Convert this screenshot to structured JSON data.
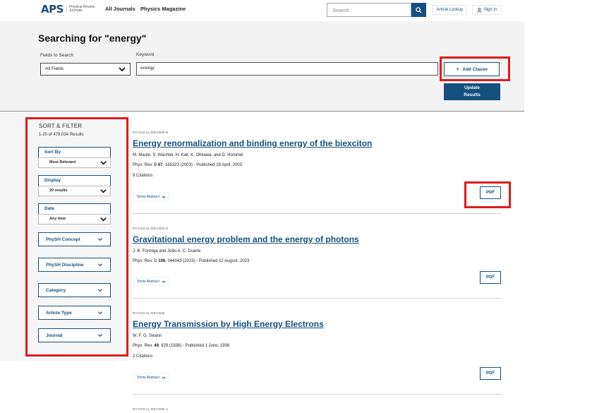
{
  "header": {
    "logo_text": "APS",
    "logo_sub": "Physical Review Journals",
    "nav": [
      "All Journals",
      "Physics Magazine"
    ],
    "search_placeholder": "Search",
    "article_lookup": "Article Lookup",
    "sign_in": "Sign in"
  },
  "search": {
    "title": "Searching for \"energy\"",
    "fields_label": "Fields to Search",
    "fields_value": "All Fields",
    "keyword_label": "Keyword",
    "keyword_value": "energy",
    "add_clause": "Add Clause",
    "update_line1": "Update",
    "update_line2": "Results"
  },
  "sidebar": {
    "title": "SORT & FILTER",
    "count": "1-20 of 479,034 Results",
    "sort_by": {
      "label": "Sort By",
      "value": "Most Relevant"
    },
    "display": {
      "label": "Display",
      "value": "20 results"
    },
    "date": {
      "label": "Date",
      "value": "Any time"
    },
    "facets": [
      "PhySH Concept",
      "PhySH Discipline",
      "Category",
      "Article Type",
      "Journal"
    ]
  },
  "results": [
    {
      "journal": "PHYSICAL REVIEW B",
      "title": "Energy renormalization and binding energy of the biexciton",
      "authors": "M. Maute, S. Wachter, H. Kalt, K. Ohkawa, and D. Hommel",
      "cite_prefix": "Phys. Rev. B ",
      "cite_volume": "67",
      "cite_suffix": ", 165323 (2003) - Published 28 April, 2003",
      "citations": "9 Citations",
      "abstract_label": "Show Abstract",
      "pdf_label": "PDF"
    },
    {
      "journal": "PHYSICAL REVIEW D",
      "title": "Gravitational energy problem and the energy of photons",
      "authors": "J. B. Formiga and João A. C. Duarte",
      "cite_prefix": "Phys. Rev. D ",
      "cite_volume": "108",
      "cite_suffix": ", 044043 (2023) - Published 22 August, 2023",
      "citations": "",
      "abstract_label": "Show Abstract",
      "pdf_label": "PDF"
    },
    {
      "journal": "PHYSICAL REVIEW",
      "title": "Energy Transmission by High Energy Electrons",
      "authors": "W. F. G. Swann",
      "cite_prefix": "Phys. Rev. ",
      "cite_volume": "49",
      "cite_suffix": ", 829 (1936) - Published 1 June, 1936",
      "citations": "2 Citations",
      "abstract_label": "Show Abstract",
      "pdf_label": "PDF"
    },
    {
      "journal": "PHYSICAL REVIEW C"
    }
  ],
  "colors": {
    "brand": "#15507f",
    "highlight": "#e01b1b"
  },
  "icons": [
    "search-icon",
    "user-icon",
    "plus-icon",
    "chevron-down-icon"
  ]
}
